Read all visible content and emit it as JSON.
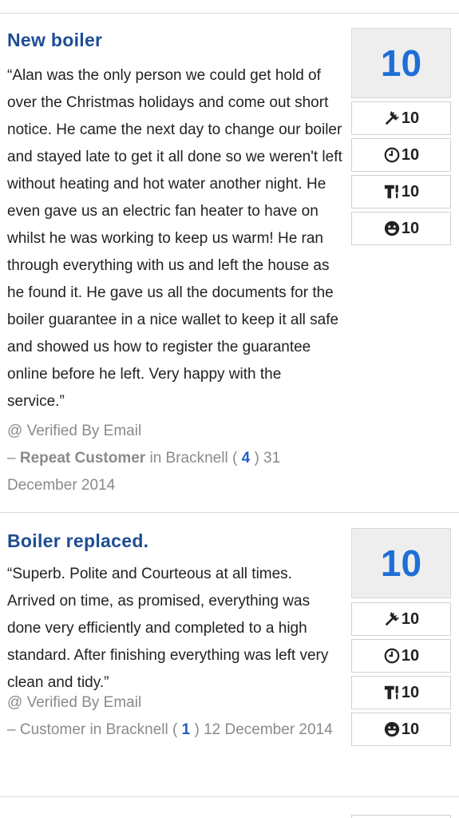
{
  "reviews": [
    {
      "title": "New boiler",
      "text": "“Alan was the only person we could get hold of over the Christmas holidays and come out short notice. He came the next day to change our boiler and stayed late to get it all done so we weren't left without heating and hot water another night. He even gave us an electric fan heater to have on whilst he was working to keep us warm! He ran through everything with us and left the house as he found it. He gave us all the documents for the boiler guarantee in a nice wallet to keep it all safe and showed us how to register the guarantee online before he left. Very happy with the service.”",
      "verified": "@ Verified By Email",
      "dash": "–",
      "customer": "Repeat Customer",
      "customer_bold": true,
      "location": "in Bracknell (",
      "count": "4",
      "date": ") 31 December 2014",
      "score": "10",
      "subscores": [
        {
          "icon": "tools-icon",
          "value": "10"
        },
        {
          "icon": "clock-icon",
          "value": "10"
        },
        {
          "icon": "tidy-icon",
          "value": "10"
        },
        {
          "icon": "smiley-icon",
          "value": "10"
        }
      ]
    },
    {
      "title": "Boiler replaced.",
      "text": "“Superb. Polite and Courteous at all times. Arrived on time, as promised, everything was done very efficiently and completed to a high standard. After finishing everything was left very clean and tidy.”",
      "verified": "@ Verified By Email",
      "dash": "–",
      "customer": "Customer",
      "customer_bold": false,
      "location": "in Bracknell (",
      "count": "1",
      "date": ") 12 December 2014",
      "score": "10",
      "subscores": [
        {
          "icon": "tools-icon",
          "value": "10"
        },
        {
          "icon": "clock-icon",
          "value": "10"
        },
        {
          "icon": "tidy-icon",
          "value": "10"
        },
        {
          "icon": "smiley-icon",
          "value": "10"
        }
      ]
    }
  ]
}
